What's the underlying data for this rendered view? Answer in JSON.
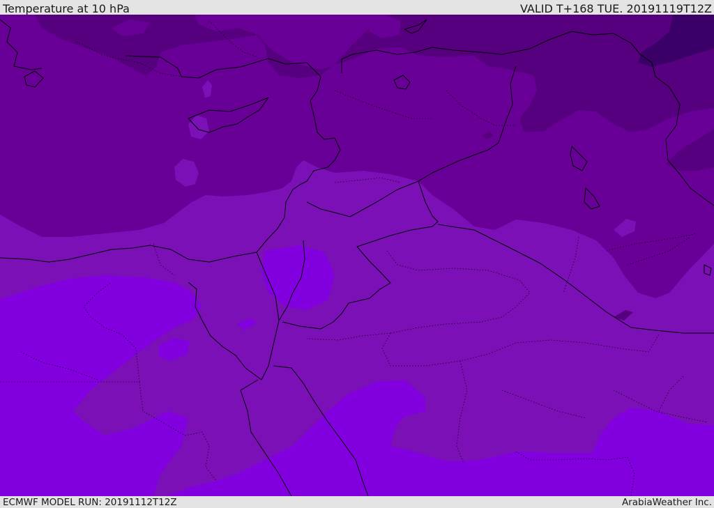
{
  "header": {
    "title": "Temperature at 10 hPa",
    "valid": "VALID T+168 TUE. 20191119T12Z"
  },
  "footer": {
    "model_run": "ECMWF MODEL RUN: 20191112T12Z",
    "credit": "ArabiaWeather Inc."
  },
  "colors": {
    "band_coldest": "#3a0068",
    "band_cold": "#57007f",
    "band_mid": "#680097",
    "band_warm": "#7a10b6",
    "band_warmest": "#8200df",
    "border_line": "#000000",
    "header_bg": "#e4e4e4"
  }
}
